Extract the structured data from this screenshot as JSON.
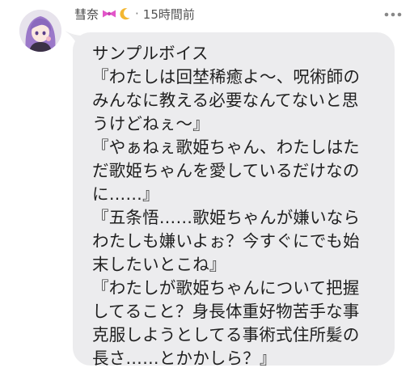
{
  "post": {
    "username": "彗奈",
    "separator": "·",
    "timestamp": "15時間前",
    "ribbon_icon_color": "#e255c9",
    "moon_icon_color": "#f3b731",
    "bubble_color": "#ececee",
    "lines": [
      "サンプルボイス",
      "『わたしは回埜稀癒よ〜、呪術師の",
      "みんなに教える必要なんてないと思",
      "うけどねぇ〜』",
      "『やぁねぇ歌姫ちゃん、わたしはた",
      "だ歌姫ちゃんを愛しているだけなの",
      "に……』",
      "『五条悟……歌姫ちゃんが嫌いなら",
      "わたしも嫌いよぉ？今すぐにでも始",
      "末したいとこね』",
      "『わたしが歌姫ちゃんについて把握",
      "してること？身長体重好物苦手な事",
      "克服しようとしてる事術式住所髪の",
      "長さ……とかかしら？』"
    ]
  }
}
